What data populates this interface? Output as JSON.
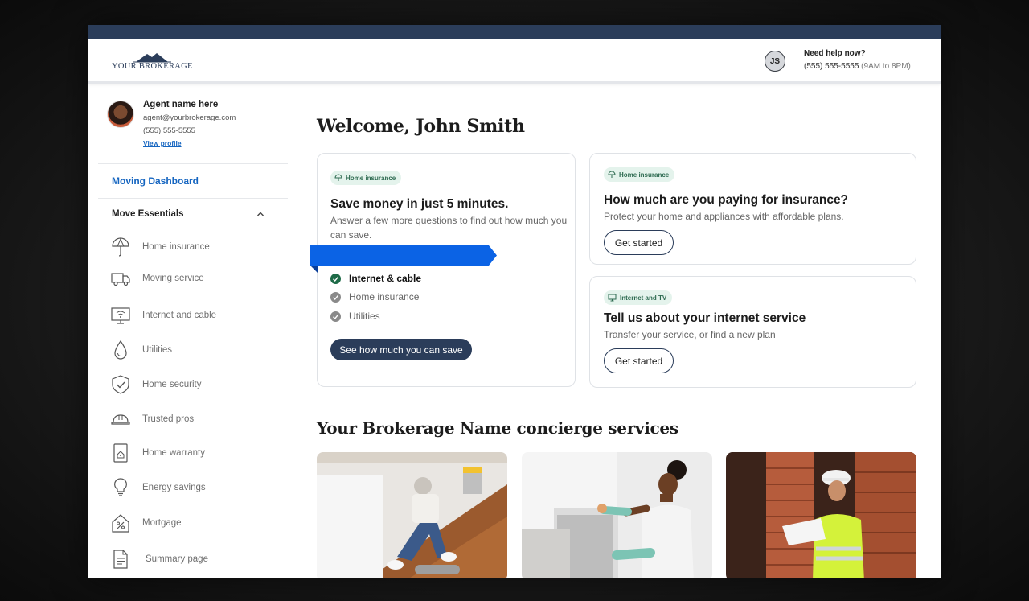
{
  "brand": {
    "logo_text": "YOUR BROKERAGE"
  },
  "header": {
    "user_initials": "JS",
    "help_title": "Need help now?",
    "help_phone": "(555) 555-5555",
    "help_hours": "(9AM to 8PM)"
  },
  "agent": {
    "name": "Agent name here",
    "email": "agent@yourbrokerage.com",
    "phone": "(555) 555-5555",
    "profile_link": "View profile"
  },
  "sidebar": {
    "dashboard_link": "Moving Dashboard",
    "section_title": "Move Essentials",
    "items": [
      {
        "label": "Home insurance",
        "icon": "umbrella-icon"
      },
      {
        "label": "Moving service",
        "icon": "truck-icon"
      },
      {
        "label": "Internet and cable",
        "icon": "wifi-monitor-icon"
      },
      {
        "label": "Utilities",
        "icon": "water-drop-icon"
      },
      {
        "label": "Home security",
        "icon": "shield-check-icon"
      },
      {
        "label": "Trusted pros",
        "icon": "hard-hat-icon"
      },
      {
        "label": "Home warranty",
        "icon": "warranty-doc-icon"
      },
      {
        "label": "Energy savings",
        "icon": "lightbulb-icon"
      },
      {
        "label": "Mortgage",
        "icon": "percent-house-icon"
      },
      {
        "label": "Summary page",
        "icon": "document-icon"
      }
    ]
  },
  "main": {
    "welcome": "Welcome, John Smith",
    "save_card": {
      "badge": "Home insurance",
      "title": "Save money in just 5 minutes.",
      "text": "Answer a few more questions to find out how much you can save.",
      "checklist": [
        {
          "label": "Internet & cable",
          "done": true
        },
        {
          "label": "Home insurance",
          "done": false
        },
        {
          "label": "Utilities",
          "done": false
        }
      ],
      "button": "See how much you can save"
    },
    "insurance_card": {
      "badge": "Home insurance",
      "title": "How much are you paying for insurance?",
      "text": "Protect your home and appliances with affordable plans.",
      "button": "Get started"
    },
    "internet_card": {
      "badge": "Internet and TV",
      "title": "Tell us about your internet service",
      "text": "Transfer your service, or find a new plan",
      "button": "Get started"
    },
    "concierge_title": "Your Brokerage Name concierge services"
  },
  "colors": {
    "navy": "#2b3d5a",
    "link_blue": "#1565c0",
    "ribbon_blue": "#0b63e5",
    "badge_green_bg": "#e4f3ec",
    "check_green": "#2d6a50"
  }
}
